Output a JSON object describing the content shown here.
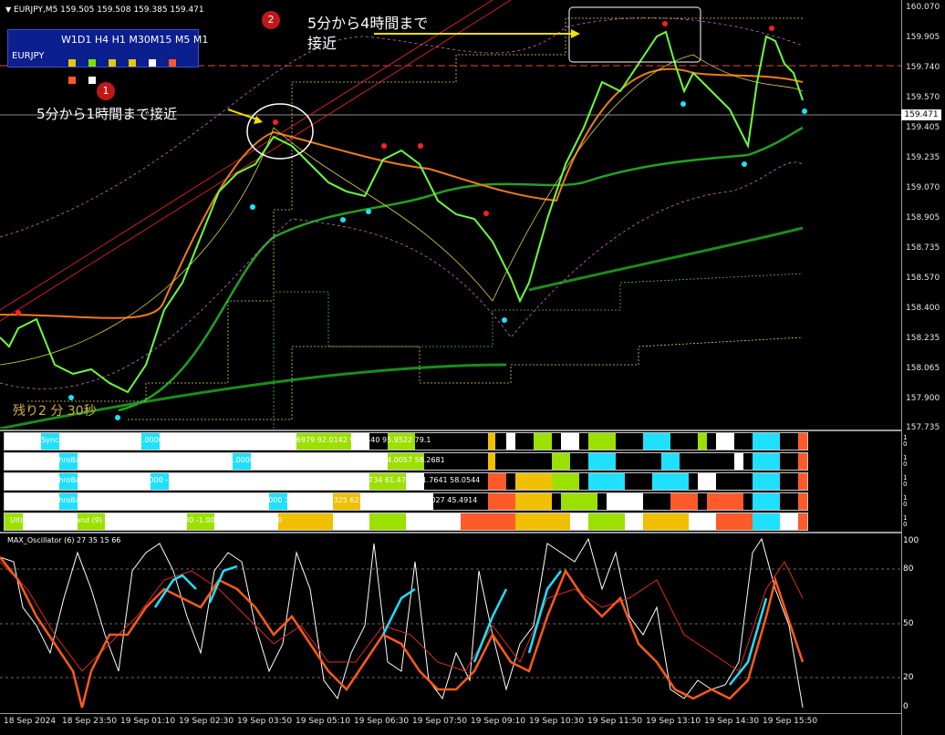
{
  "header": {
    "symbol": "EURJPY,M5",
    "ohlc": "159.505 159.508 159.385 159.471"
  },
  "timeframe_panel": {
    "label": "W1D1 H4 H1 M30M15 M5 M1",
    "symbol": "EURJPY",
    "dots": [
      "#e8c800",
      "#7ee000",
      "#e8c800",
      "#e8c800",
      "#ffffff",
      "#ff5a2a",
      "#ff5a2a",
      "#ffffff"
    ]
  },
  "annotations": {
    "badge1": "1",
    "badge2": "2",
    "text1": "5分から1時間まで接近",
    "text2_line1": "5分から4時間まで",
    "text2_line2": "接近",
    "remaining": "残り2 分 30秒"
  },
  "price_axis": {
    "labels": [
      "160.070",
      "159.905",
      "159.740",
      "159.570",
      "159.405",
      "159.235",
      "159.070",
      "158.905",
      "158.735",
      "158.570",
      "158.400",
      "158.235",
      "158.065",
      "157.900",
      "157.735"
    ],
    "current": "159.471"
  },
  "time_axis": {
    "labels": [
      "18 Sep 2024",
      "18 Sep 23:50",
      "19 Sep 01:10",
      "19 Sep 02:30",
      "19 Sep 03:50",
      "19 Sep 05:10",
      "19 Sep 06:30",
      "19 Sep 07:50",
      "19 Sep 09:10",
      "19 Sep 10:30",
      "19 Sep 11:50",
      "19 Sep 13:10",
      "19 Sep 14:30",
      "19 Sep 15:50"
    ]
  },
  "indicators": [
    {
      "label": "UltimateSynchroBand (9) -1.0000 -1.0000 -1.0000 -1.0000 -1.0000 1.0000 85.6979 92.0142 96.8440 95.9522 79.1"
    },
    {
      "label": "UltimateSynchroBand (9) -1.0000 -1.0000 -1.0000 -1.0000 -1.0000 1.0000 69.6841 71.7394 82.2593 84.0057 58.2681"
    },
    {
      "label": "UltimateSynchroBand (9) -1.0000 -1.0000 -1.0000 -1.0000 -1.0000 -1.0000 64.4053 68.2016 54.8734 61.4765 81.7641 58.0544"
    },
    {
      "label": "UltimateSynchroBand (9) -1.0000 -1.0000 -1.0000 -1.0000 -1.0000 1.0000 35.4612 42.3325 62.1555 61.0332 64.9027 45.4914"
    },
    {
      "label": "UltimateSynchroBand (9) -1.0000 -1.0000 -1.0000 -1.0000 -1.0000 1.0000"
    }
  ],
  "indicator_scale": [
    "1",
    "0"
  ],
  "oscillator": {
    "label": "MAX_Oscillator (6) 27 35 15 66",
    "levels": [
      "100",
      "80",
      "50",
      "20",
      "0"
    ]
  }
}
